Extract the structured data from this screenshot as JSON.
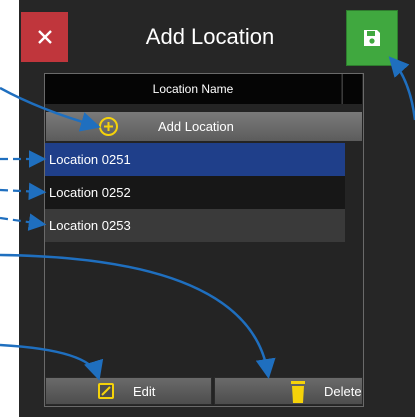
{
  "dialog": {
    "title": "Add Location",
    "close_icon": "close-x-icon",
    "save_icon": "floppy-disk-icon"
  },
  "list": {
    "column_header": "Location Name",
    "add_label": "Add Location",
    "add_icon": "plus-circle-icon",
    "items": [
      {
        "label": "Location 0251",
        "selected": true
      },
      {
        "label": "Location 0252",
        "selected": false
      },
      {
        "label": "Location 0253",
        "selected": false
      }
    ]
  },
  "toolbar": {
    "edit_label": "Edit",
    "edit_icon": "edit-pencil-icon",
    "delete_label": "Delete",
    "delete_icon": "trash-icon"
  },
  "colors": {
    "close": "#c0363c",
    "save": "#40a83f",
    "selected_row": "#1f3f8a",
    "accent_icon": "#f5d20a",
    "callout_arrow": "#1f6fbf"
  }
}
